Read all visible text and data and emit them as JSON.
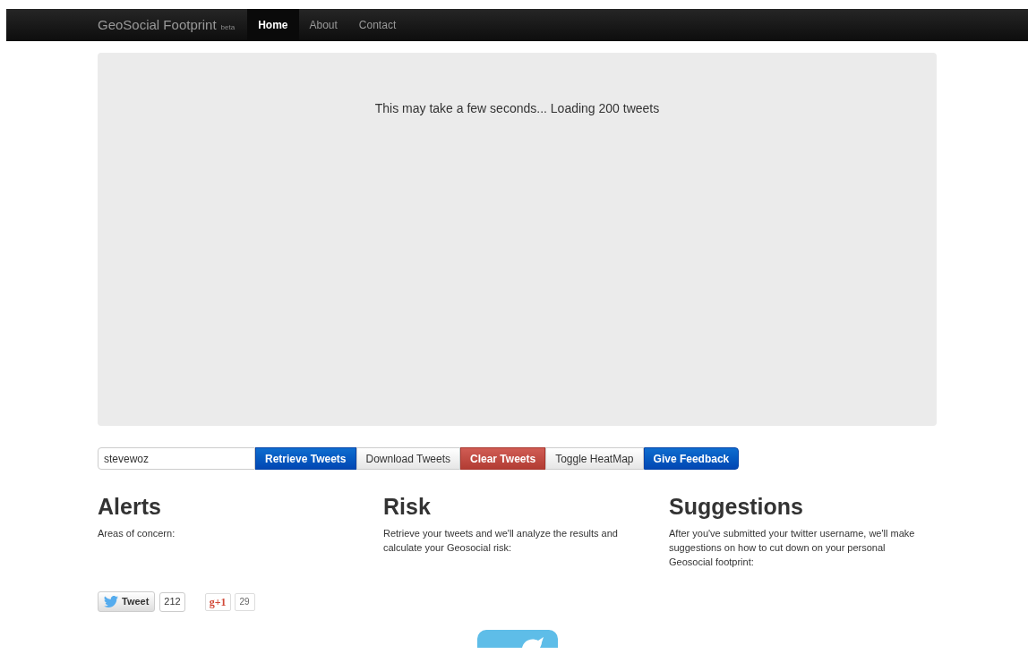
{
  "navbar": {
    "brand": "GeoSocial Footprint",
    "brand_badge": "beta",
    "links": [
      {
        "label": "Home",
        "selected": true
      },
      {
        "label": "About",
        "selected": false
      },
      {
        "label": "Contact",
        "selected": false
      }
    ]
  },
  "map_panel": {
    "message": "This may take a few seconds... Loading 200 tweets"
  },
  "username_field": {
    "value": "stevewoz"
  },
  "buttons": [
    {
      "label": "Retrieve Tweets",
      "kind": "primary"
    },
    {
      "label": "Download Tweets",
      "kind": "default"
    },
    {
      "label": "Clear Tweets",
      "kind": "danger"
    },
    {
      "label": "Toggle HeatMap",
      "kind": "default"
    },
    {
      "label": "Give Feedback",
      "kind": "primary"
    }
  ],
  "sections": [
    {
      "title": "Alerts",
      "text": "Areas of concern:"
    },
    {
      "title": "Risk",
      "text": "Retrieve your tweets and we'll analyze the results and calculate your Geosocial risk:"
    },
    {
      "title": "Suggestions",
      "text": "After you've submitted your twitter username, we'll make suggestions on how to cut down on your personal Geosocial footprint:"
    }
  ],
  "share": {
    "tweet_label": "Tweet",
    "tweet_count": "212",
    "plusone_label": "g+1",
    "plusone_count": "29"
  }
}
